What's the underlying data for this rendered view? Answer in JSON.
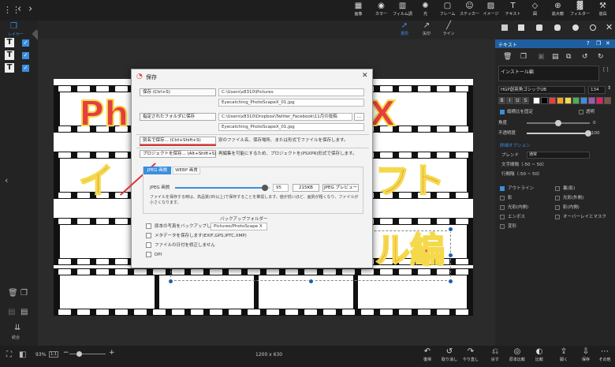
{
  "topbar": {
    "tools": [
      {
        "icon": "image-edit-icon",
        "label": "画像"
      },
      {
        "icon": "color-icon",
        "label": "カラー"
      },
      {
        "icon": "film-icon",
        "label": "フィルム調"
      },
      {
        "icon": "light-icon",
        "label": "光"
      },
      {
        "icon": "frame-icon",
        "label": "フレーム"
      },
      {
        "icon": "sticker-icon",
        "label": "ステッカー"
      },
      {
        "icon": "image-icon",
        "label": "イメージ"
      },
      {
        "icon": "text-icon",
        "label": "テキスト"
      },
      {
        "icon": "figure-icon",
        "label": "図"
      },
      {
        "icon": "zoom-icon",
        "label": "拡大鏡"
      },
      {
        "icon": "filter-icon",
        "label": "フィルター"
      },
      {
        "icon": "tools-icon",
        "label": "道具"
      }
    ]
  },
  "leftbar": {
    "layer_label": "レイヤー",
    "combine_label": "結合",
    "pro_badge": "PRO"
  },
  "subbar": {
    "select_label": "選択",
    "arrow_label": "矢印",
    "line_label": "ライン"
  },
  "canvas": {
    "line1": "Ph",
    "line1b": "X",
    "line2": "イ",
    "line2b": "フト",
    "line3": "ル編"
  },
  "dialog": {
    "title": "保存",
    "save_btn": "保存 (Ctrl+S)",
    "save_path": "C:\\Users\\x8310\\Pictures",
    "save_file": "Eyecatching_PhotoScapeX_01.jpg",
    "folder_btn": "指定されたフォルダに保存",
    "folder_path": "C:\\Users\\x8310\\Dropbox\\Twitter_Facebook\\11月の投稿",
    "folder_file": "Eyecatching_PhotoScapeX_01.jpg",
    "browse_btn": "...",
    "saveas_btn": "別名で保存... (Ctrl+Shift+S)",
    "saveas_desc": "別のファイル名、保存場所、または形式でファイルを保存します。",
    "project_btn": "プロジェクトを保存... (Alt+Shift+S)",
    "project_desc": "再編集を可能にするため、プロジェクトを(PSXPR)形式で保存します。",
    "tab_jpeg": "JPEG 画質",
    "tab_webp": "WEBP 画質",
    "quality_label": "JPEG 画質",
    "quality_value": "95",
    "quality_fraction": 0.95,
    "size_value": "215KB",
    "preview_btn": "JPEG プレビュー",
    "quality_note": "ファイルを保存する時は、高品質(95以上)で保存することを推奨します。値が低いほど、画質が粗くなり、ファイルが小さくなります。",
    "backup_title": "バックアップフォルダー",
    "opt_backup": "原本の写真をバックアップします",
    "backup_folder": "Pictures/PhotoScape X",
    "opt_meta": "メタデータを保存します(EXIF,GPS,IPTC,XMP)",
    "opt_date": "ファイルの日付を修正しません",
    "opt_dpi": "DPI"
  },
  "rightpanel": {
    "header": "テキスト",
    "text_value": "インストール編",
    "font_name": "HGP創英角ゴシックUB",
    "font_size": "134",
    "vertical_label": "縦横比を固定",
    "transparent_label": "透明",
    "angle_label": "角度",
    "angle_value": "0",
    "opacity_label": "不透明度",
    "opacity_value": "100",
    "detail_label": "詳細オプション",
    "blend_label": "ブレンド",
    "blend_value": "通常",
    "char_spacing": "文字間隔（-50 ~ 50）",
    "line_spacing": "行間隔（-50 ~ 50）",
    "effects": [
      {
        "label": "アウトライン",
        "checked": true
      },
      {
        "label": "裏(影)",
        "checked": false
      },
      {
        "label": "影",
        "checked": false
      },
      {
        "label": "光彩(外側)",
        "checked": false
      },
      {
        "label": "光彩(内側)",
        "checked": false
      },
      {
        "label": "影(内側)",
        "checked": false
      },
      {
        "label": "エンボス",
        "checked": false
      },
      {
        "label": "オーバーレイとマスク",
        "checked": false
      },
      {
        "label": "変形",
        "checked": false
      }
    ],
    "colors": [
      "#ffffff",
      "#000000",
      "#e53f3f",
      "#f5a623",
      "#f4d94b",
      "#4caf50",
      "#3b8ee0",
      "#9b59b6",
      "#e91e63",
      "#795548"
    ]
  },
  "bottombar": {
    "zoom": "93%",
    "ratio": "1:1",
    "zoom_fraction": 0.25,
    "image_size": "1200 x 630",
    "buttons": [
      {
        "icon": "undo-icon",
        "label": "復帰"
      },
      {
        "icon": "redo-icon",
        "label": "取り消し"
      },
      {
        "icon": "redo-all-icon",
        "label": "やり直し"
      },
      {
        "icon": "revert-icon",
        "label": "戻す"
      },
      {
        "icon": "compare-icon",
        "label": "原本比較"
      },
      {
        "icon": "compare2-icon",
        "label": "比較"
      },
      {
        "icon": "share-icon",
        "label": "開く"
      },
      {
        "icon": "save-icon",
        "label": "保存"
      },
      {
        "icon": "more-icon",
        "label": "その他"
      }
    ]
  }
}
